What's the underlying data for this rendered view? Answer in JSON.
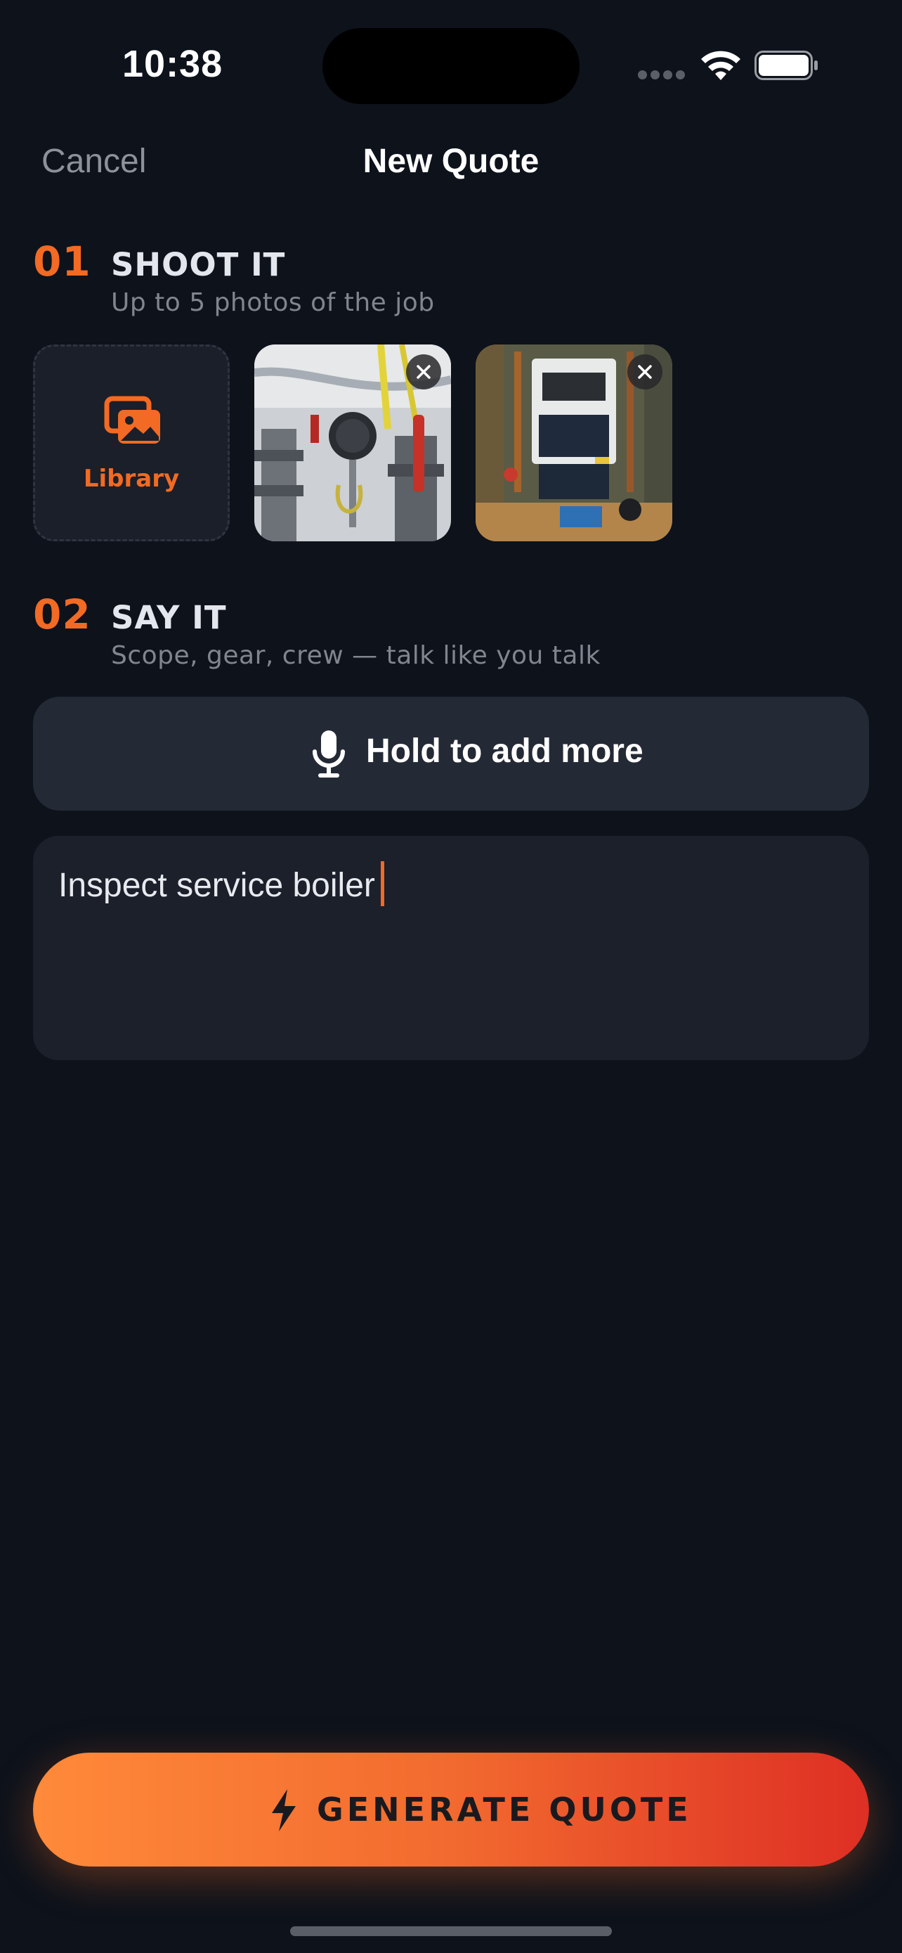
{
  "status_bar": {
    "time": "10:38",
    "icons": [
      "cellular-signal-icon",
      "wifi-icon",
      "battery-icon"
    ]
  },
  "nav": {
    "cancel_label": "Cancel",
    "title": "New Quote"
  },
  "step1": {
    "number": "01",
    "title": "SHOOT IT",
    "subtitle": "Up to 5 photos of the job",
    "library_label": "Library",
    "photos": [
      {
        "description_icon": "photo-thumbnail-pipes-valves"
      },
      {
        "description_icon": "photo-thumbnail-boiler-unit"
      }
    ]
  },
  "step2": {
    "number": "02",
    "title": "SAY IT",
    "subtitle": "Scope, gear, crew — talk like you talk",
    "voice_button_label": "Hold to add more",
    "notes_text": "Inspect service boiler"
  },
  "generate_button_label": "GENERATE QUOTE",
  "colors": {
    "background": "#0d121b",
    "accent": "#f26a23",
    "gradient_start": "#ff8a3a",
    "gradient_end": "#de2f24",
    "surface": "#242a35"
  }
}
